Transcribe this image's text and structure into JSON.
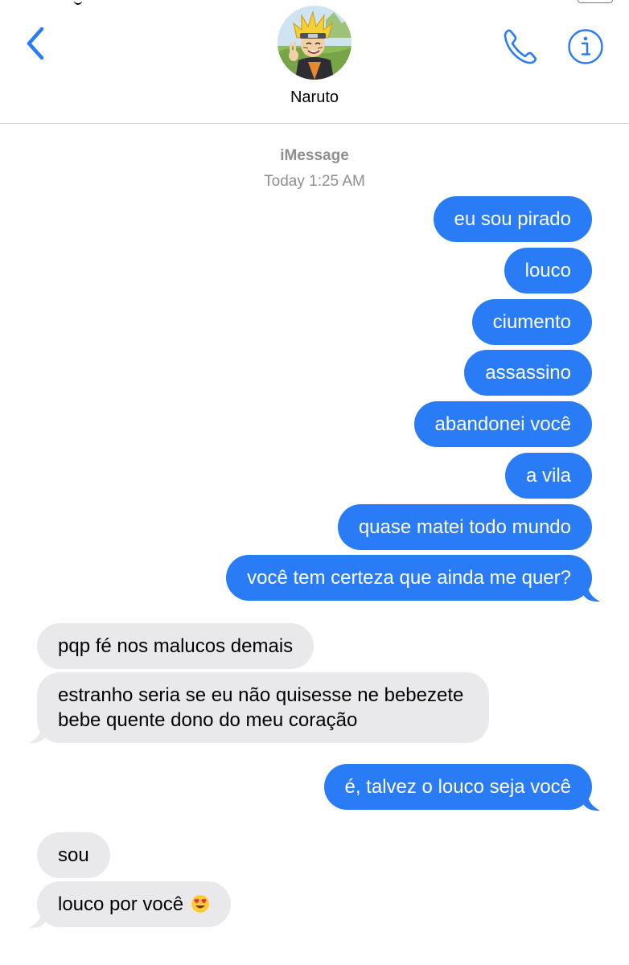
{
  "header": {
    "contact_name": "Naruto"
  },
  "meta": {
    "service": "iMessage",
    "day": "Today",
    "time": "1:25 AM"
  },
  "messages": [
    {
      "text": "eu sou pirado",
      "from": "me"
    },
    {
      "text": "louco",
      "from": "me"
    },
    {
      "text": "ciumento",
      "from": "me"
    },
    {
      "text": "assassino",
      "from": "me"
    },
    {
      "text": "abandonei você",
      "from": "me"
    },
    {
      "text": "a vila",
      "from": "me"
    },
    {
      "text": "quase matei todo mundo",
      "from": "me"
    },
    {
      "text": "você tem certeza que ainda me quer?",
      "from": "me"
    },
    {
      "text": "pqp fé nos malucos demais",
      "from": "them"
    },
    {
      "text": "estranho seria se eu não quisesse ne bebezete bebe quente dono do meu coração",
      "from": "them"
    },
    {
      "text": "é, talvez o louco seja você",
      "from": "me"
    },
    {
      "text": "sou",
      "from": "them"
    },
    {
      "text": "louco por você",
      "from": "them",
      "emoji": "heart-eyes-emoji"
    }
  ],
  "colors": {
    "outgoing_bubble": "#2a7cf6",
    "incoming_bubble": "#e9e9eb",
    "accent": "#2a7cf6",
    "meta_text": "#8e8e93"
  },
  "icons": [
    "back-chevron-icon",
    "contact-avatar",
    "phone-icon",
    "info-icon",
    "heart-eyes-emoji"
  ]
}
